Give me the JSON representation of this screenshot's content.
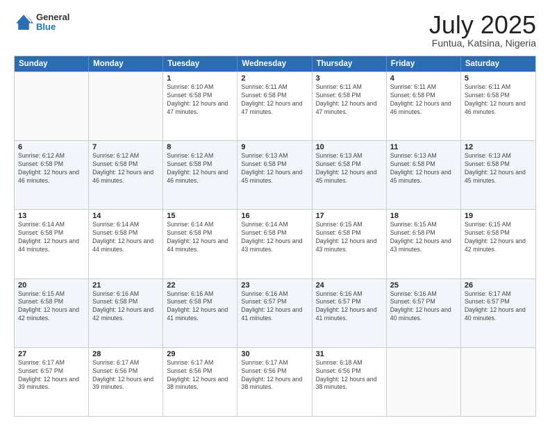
{
  "logo": {
    "line1": "General",
    "line2": "Blue"
  },
  "title": "July 2025",
  "subtitle": "Funtua, Katsina, Nigeria",
  "weekdays": [
    "Sunday",
    "Monday",
    "Tuesday",
    "Wednesday",
    "Thursday",
    "Friday",
    "Saturday"
  ],
  "weeks": [
    [
      {
        "day": "",
        "sunrise": "",
        "sunset": "",
        "daylight": "",
        "empty": true
      },
      {
        "day": "",
        "sunrise": "",
        "sunset": "",
        "daylight": "",
        "empty": true
      },
      {
        "day": "1",
        "sunrise": "Sunrise: 6:10 AM",
        "sunset": "Sunset: 6:58 PM",
        "daylight": "Daylight: 12 hours and 47 minutes."
      },
      {
        "day": "2",
        "sunrise": "Sunrise: 6:11 AM",
        "sunset": "Sunset: 6:58 PM",
        "daylight": "Daylight: 12 hours and 47 minutes."
      },
      {
        "day": "3",
        "sunrise": "Sunrise: 6:11 AM",
        "sunset": "Sunset: 6:58 PM",
        "daylight": "Daylight: 12 hours and 47 minutes."
      },
      {
        "day": "4",
        "sunrise": "Sunrise: 6:11 AM",
        "sunset": "Sunset: 6:58 PM",
        "daylight": "Daylight: 12 hours and 46 minutes."
      },
      {
        "day": "5",
        "sunrise": "Sunrise: 6:11 AM",
        "sunset": "Sunset: 6:58 PM",
        "daylight": "Daylight: 12 hours and 46 minutes."
      }
    ],
    [
      {
        "day": "6",
        "sunrise": "Sunrise: 6:12 AM",
        "sunset": "Sunset: 6:58 PM",
        "daylight": "Daylight: 12 hours and 46 minutes."
      },
      {
        "day": "7",
        "sunrise": "Sunrise: 6:12 AM",
        "sunset": "Sunset: 6:58 PM",
        "daylight": "Daylight: 12 hours and 46 minutes."
      },
      {
        "day": "8",
        "sunrise": "Sunrise: 6:12 AM",
        "sunset": "Sunset: 6:58 PM",
        "daylight": "Daylight: 12 hours and 46 minutes."
      },
      {
        "day": "9",
        "sunrise": "Sunrise: 6:13 AM",
        "sunset": "Sunset: 6:58 PM",
        "daylight": "Daylight: 12 hours and 45 minutes."
      },
      {
        "day": "10",
        "sunrise": "Sunrise: 6:13 AM",
        "sunset": "Sunset: 6:58 PM",
        "daylight": "Daylight: 12 hours and 45 minutes."
      },
      {
        "day": "11",
        "sunrise": "Sunrise: 6:13 AM",
        "sunset": "Sunset: 6:58 PM",
        "daylight": "Daylight: 12 hours and 45 minutes."
      },
      {
        "day": "12",
        "sunrise": "Sunrise: 6:13 AM",
        "sunset": "Sunset: 6:58 PM",
        "daylight": "Daylight: 12 hours and 45 minutes."
      }
    ],
    [
      {
        "day": "13",
        "sunrise": "Sunrise: 6:14 AM",
        "sunset": "Sunset: 6:58 PM",
        "daylight": "Daylight: 12 hours and 44 minutes."
      },
      {
        "day": "14",
        "sunrise": "Sunrise: 6:14 AM",
        "sunset": "Sunset: 6:58 PM",
        "daylight": "Daylight: 12 hours and 44 minutes."
      },
      {
        "day": "15",
        "sunrise": "Sunrise: 6:14 AM",
        "sunset": "Sunset: 6:58 PM",
        "daylight": "Daylight: 12 hours and 44 minutes."
      },
      {
        "day": "16",
        "sunrise": "Sunrise: 6:14 AM",
        "sunset": "Sunset: 6:58 PM",
        "daylight": "Daylight: 12 hours and 43 minutes."
      },
      {
        "day": "17",
        "sunrise": "Sunrise: 6:15 AM",
        "sunset": "Sunset: 6:58 PM",
        "daylight": "Daylight: 12 hours and 43 minutes."
      },
      {
        "day": "18",
        "sunrise": "Sunrise: 6:15 AM",
        "sunset": "Sunset: 6:58 PM",
        "daylight": "Daylight: 12 hours and 43 minutes."
      },
      {
        "day": "19",
        "sunrise": "Sunrise: 6:15 AM",
        "sunset": "Sunset: 6:58 PM",
        "daylight": "Daylight: 12 hours and 42 minutes."
      }
    ],
    [
      {
        "day": "20",
        "sunrise": "Sunrise: 6:15 AM",
        "sunset": "Sunset: 6:58 PM",
        "daylight": "Daylight: 12 hours and 42 minutes."
      },
      {
        "day": "21",
        "sunrise": "Sunrise: 6:16 AM",
        "sunset": "Sunset: 6:58 PM",
        "daylight": "Daylight: 12 hours and 42 minutes."
      },
      {
        "day": "22",
        "sunrise": "Sunrise: 6:16 AM",
        "sunset": "Sunset: 6:58 PM",
        "daylight": "Daylight: 12 hours and 41 minutes."
      },
      {
        "day": "23",
        "sunrise": "Sunrise: 6:16 AM",
        "sunset": "Sunset: 6:57 PM",
        "daylight": "Daylight: 12 hours and 41 minutes."
      },
      {
        "day": "24",
        "sunrise": "Sunrise: 6:16 AM",
        "sunset": "Sunset: 6:57 PM",
        "daylight": "Daylight: 12 hours and 41 minutes."
      },
      {
        "day": "25",
        "sunrise": "Sunrise: 6:16 AM",
        "sunset": "Sunset: 6:57 PM",
        "daylight": "Daylight: 12 hours and 40 minutes."
      },
      {
        "day": "26",
        "sunrise": "Sunrise: 6:17 AM",
        "sunset": "Sunset: 6:57 PM",
        "daylight": "Daylight: 12 hours and 40 minutes."
      }
    ],
    [
      {
        "day": "27",
        "sunrise": "Sunrise: 6:17 AM",
        "sunset": "Sunset: 6:57 PM",
        "daylight": "Daylight: 12 hours and 39 minutes."
      },
      {
        "day": "28",
        "sunrise": "Sunrise: 6:17 AM",
        "sunset": "Sunset: 6:56 PM",
        "daylight": "Daylight: 12 hours and 39 minutes."
      },
      {
        "day": "29",
        "sunrise": "Sunrise: 6:17 AM",
        "sunset": "Sunset: 6:56 PM",
        "daylight": "Daylight: 12 hours and 38 minutes."
      },
      {
        "day": "30",
        "sunrise": "Sunrise: 6:17 AM",
        "sunset": "Sunset: 6:56 PM",
        "daylight": "Daylight: 12 hours and 38 minutes."
      },
      {
        "day": "31",
        "sunrise": "Sunrise: 6:18 AM",
        "sunset": "Sunset: 6:56 PM",
        "daylight": "Daylight: 12 hours and 38 minutes."
      },
      {
        "day": "",
        "sunrise": "",
        "sunset": "",
        "daylight": "",
        "empty": true
      },
      {
        "day": "",
        "sunrise": "",
        "sunset": "",
        "daylight": "",
        "empty": true
      }
    ]
  ]
}
